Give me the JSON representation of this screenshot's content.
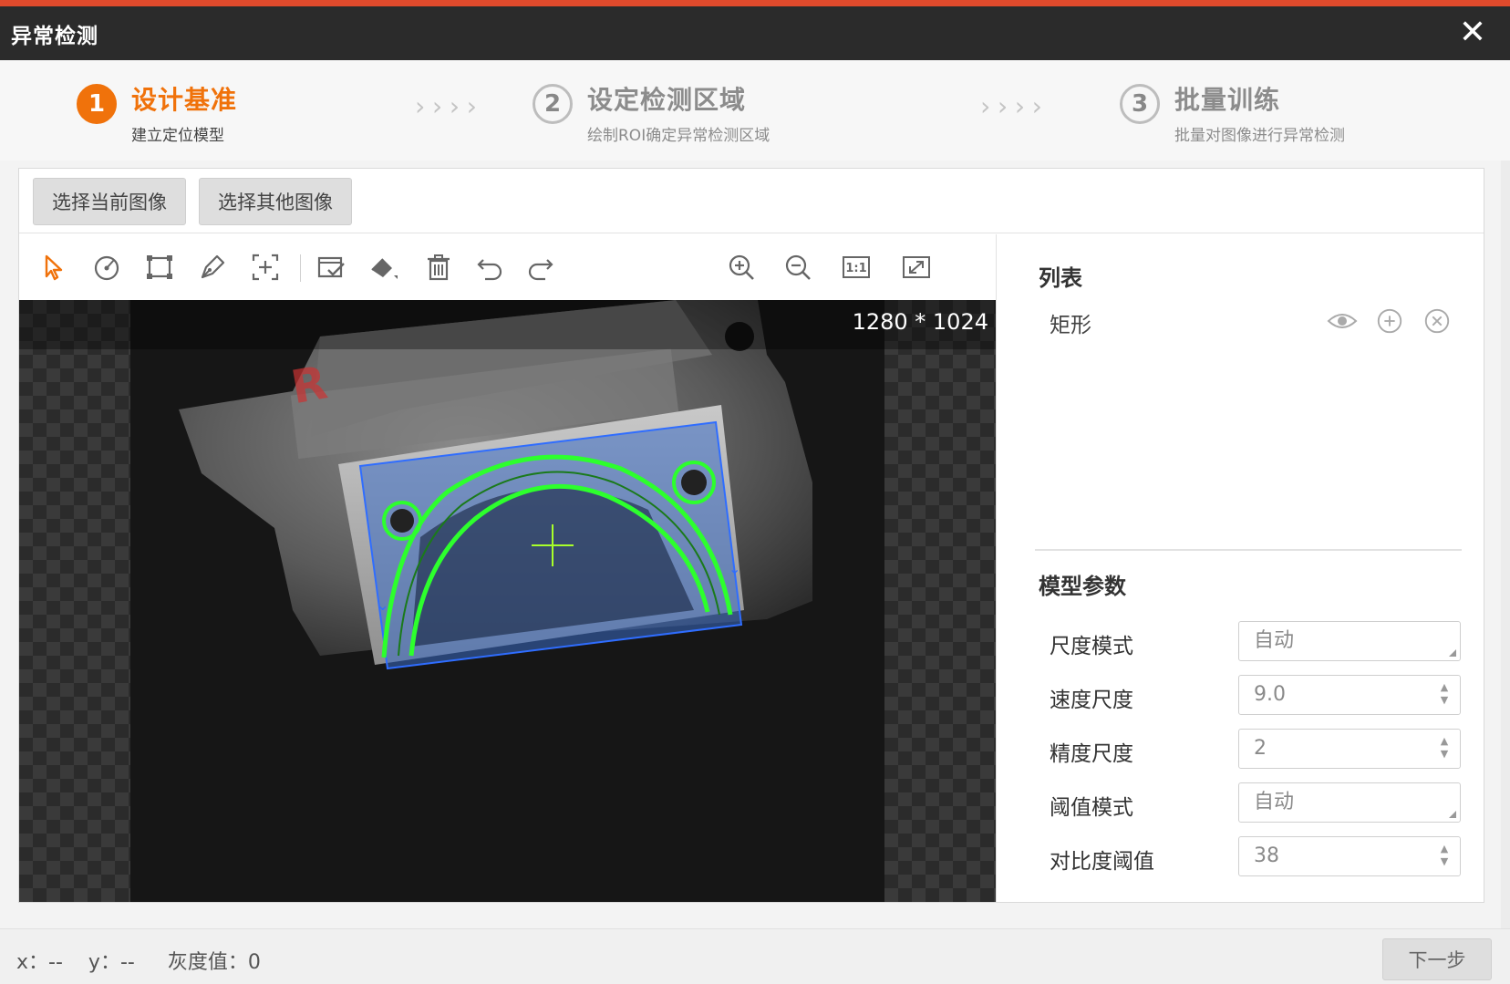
{
  "window": {
    "title": "异常检测",
    "close_label": "✕"
  },
  "steps": [
    {
      "num": "1",
      "title": "设计基准",
      "subtitle": "建立定位模型"
    },
    {
      "num": "2",
      "title": "设定检测区域",
      "subtitle": "绘制ROI确定异常检测区域"
    },
    {
      "num": "3",
      "title": "批量训练",
      "subtitle": "批量对图像进行异常检测"
    }
  ],
  "step_arrows": "››››",
  "image_buttons": {
    "current": "选择当前图像",
    "other": "选择其他图像"
  },
  "toolbar_icons": [
    "pointer-icon",
    "circle-icon",
    "rectangle-icon",
    "pen-icon",
    "crosshair-box-icon",
    "select-box-icon",
    "eraser-icon",
    "trash-icon",
    "undo-icon",
    "redo-icon",
    "zoom-in-icon",
    "zoom-out-icon",
    "actual-size-icon",
    "fit-icon"
  ],
  "actual_size_label": "1:1",
  "viewer": {
    "image_size": "1280 * 1024"
  },
  "list": {
    "title": "列表",
    "items": [
      {
        "label": "矩形"
      }
    ]
  },
  "model_params": {
    "title": "模型参数",
    "rows": [
      {
        "label": "尺度模式",
        "value": "自动",
        "kind": "select"
      },
      {
        "label": "速度尺度",
        "value": "9.0",
        "kind": "spin"
      },
      {
        "label": "精度尺度",
        "value": "2",
        "kind": "spin"
      },
      {
        "label": "阈值模式",
        "value": "自动",
        "kind": "select"
      },
      {
        "label": "对比度阈值",
        "value": "38",
        "kind": "spin"
      }
    ]
  },
  "status": {
    "x_label": "x：",
    "x_value": "--",
    "y_label": "y：",
    "y_value": "--",
    "gray_label": "灰度值：",
    "gray_value": "0"
  },
  "next_button": "下一步",
  "colors": {
    "accent": "#f0720b",
    "contour": "#2dff2d",
    "roi_fill": "#3b6cc4",
    "titlebar": "#2b2b2b"
  }
}
